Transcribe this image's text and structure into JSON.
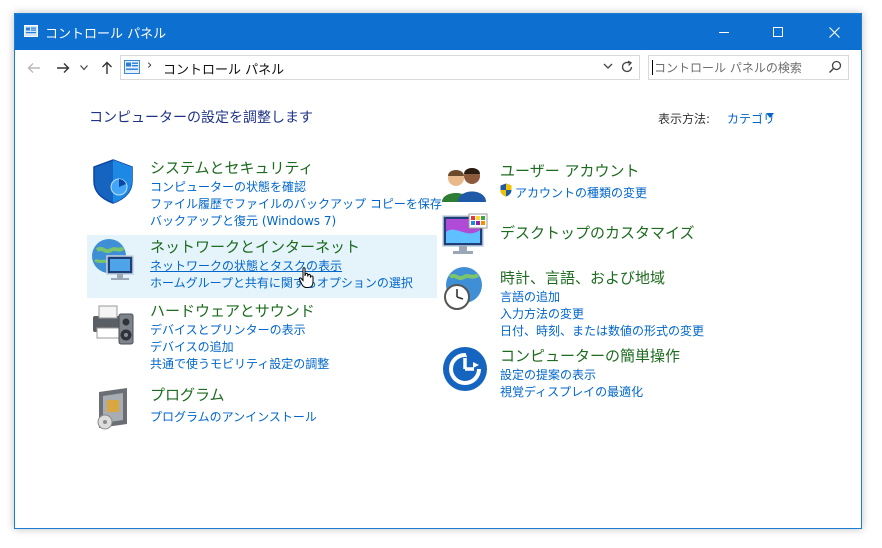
{
  "window": {
    "title": "コントロール パネル"
  },
  "address_bar": {
    "separator": "›",
    "crumb": "コントロール パネル"
  },
  "search": {
    "placeholder": "コントロール パネルの検索"
  },
  "page": {
    "heading": "コンピューターの設定を調整します",
    "view_by_label": "表示方法:",
    "view_by_value": "カテゴリ"
  },
  "categories": [
    {
      "title": "システムとセキュリティ",
      "links": [
        "コンピューターの状態を確認",
        "ファイル履歴でファイルのバックアップ コピーを保存",
        "バックアップと復元 (Windows 7)"
      ]
    },
    {
      "title": "ネットワークとインターネット",
      "links": [
        "ネットワークの状態とタスクの表示",
        "ホームグループと共有に関するオプションの選択"
      ]
    },
    {
      "title": "ハードウェアとサウンド",
      "links": [
        "デバイスとプリンターの表示",
        "デバイスの追加",
        "共通で使うモビリティ設定の調整"
      ]
    },
    {
      "title": "プログラム",
      "links": [
        "プログラムのアンインストール"
      ]
    },
    {
      "title": "ユーザー アカウント",
      "links": [
        "アカウントの種類の変更"
      ]
    },
    {
      "title": "デスクトップのカスタマイズ",
      "links": []
    },
    {
      "title": "時計、言語、および地域",
      "links": [
        "言語の追加",
        "入力方法の変更",
        "日付、時刻、または数値の形式の変更"
      ]
    },
    {
      "title": "コンピューターの簡単操作",
      "links": [
        "設定の提案の表示",
        "視覚ディスプレイの最適化"
      ]
    }
  ],
  "colors": {
    "titlebar": "#0d6fd0",
    "category_title": "#1d6b1f",
    "link": "#0066cc",
    "heading": "#1e3287",
    "hover_highlight": "#e5f3fb"
  },
  "icons": {
    "app": "control-panel-icon",
    "back": "arrow-left-icon",
    "forward": "arrow-right-icon",
    "recent": "chevron-down-icon",
    "up": "arrow-up-icon",
    "refresh": "refresh-icon",
    "search": "search-icon"
  }
}
